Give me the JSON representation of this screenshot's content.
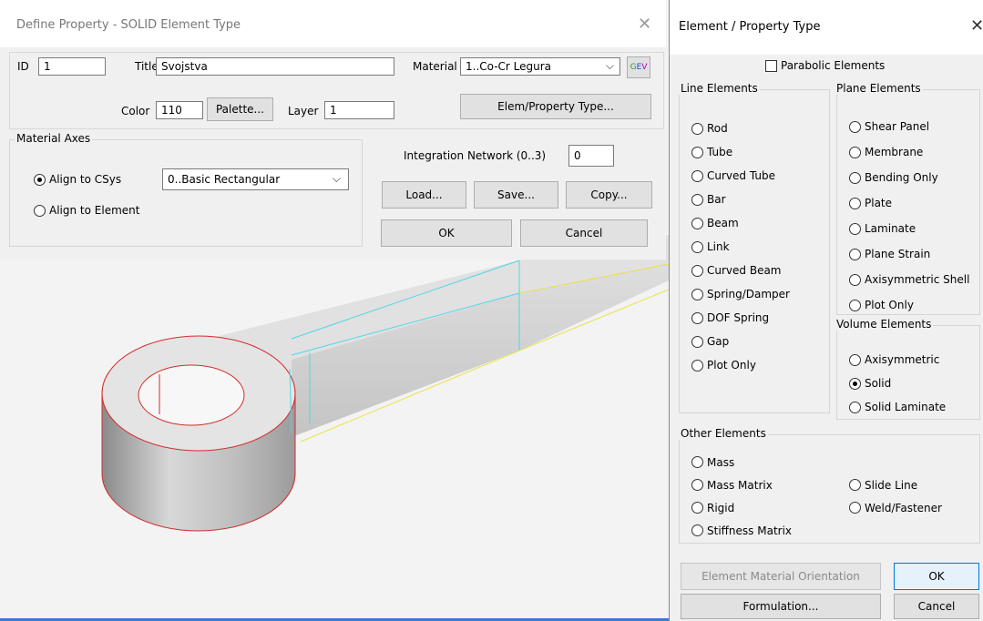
{
  "define_dialog": {
    "title": "Define Property - SOLID Element Type",
    "close": "✕",
    "id_label": "ID",
    "id_value": "1",
    "title_label": "Title",
    "title_value": "Svojstva",
    "material_label": "Material",
    "material_value": "1..Co-Cr Legura",
    "color_label": "Color",
    "color_value": "110",
    "palette_button": "Palette...",
    "layer_label": "Layer",
    "layer_value": "1",
    "elem_type_button": "Elem/Property Type...",
    "material_axes": {
      "label": "Material Axes",
      "align_csys": "Align to CSys",
      "align_element": "Align to Element",
      "csys_value": "0..Basic Rectangular"
    },
    "integration_label": "Integration Network (0..3)",
    "integration_value": "0",
    "load_button": "Load...",
    "save_button": "Save...",
    "copy_button": "Copy...",
    "ok_button": "OK",
    "cancel_button": "Cancel"
  },
  "type_dialog": {
    "title": "Element / Property Type",
    "close": "✕",
    "parabolic": "Parabolic Elements",
    "line_group": "Line Elements",
    "line_items": [
      "Rod",
      "Tube",
      "Curved Tube",
      "Bar",
      "Beam",
      "Link",
      "Curved Beam",
      "Spring/Damper",
      "DOF Spring",
      "Gap",
      "Plot Only"
    ],
    "plane_group": "Plane Elements",
    "plane_items": [
      "Shear Panel",
      "Membrane",
      "Bending Only",
      "Plate",
      "Laminate",
      "Plane Strain",
      "Axisymmetric Shell",
      "Plot Only"
    ],
    "volume_group": "Volume Elements",
    "volume_items": [
      "Axisymmetric",
      "Solid",
      "Solid Laminate"
    ],
    "other_group": "Other Elements",
    "other_left": [
      "Mass",
      "Mass Matrix",
      "Rigid",
      "Stiffness Matrix"
    ],
    "other_right": [
      "Slide Line",
      "Weld/Fastener"
    ],
    "orientation_button": "Element Material Orientation",
    "ok_button": "OK",
    "formulation_button": "Formulation...",
    "cancel_button": "Cancel"
  },
  "colors": {
    "accent": "#0078d7",
    "model_edge_red": "#d62b2b",
    "model_edge_cyan": "#4fd6e6",
    "model_edge_yellow": "#e8e24a"
  }
}
